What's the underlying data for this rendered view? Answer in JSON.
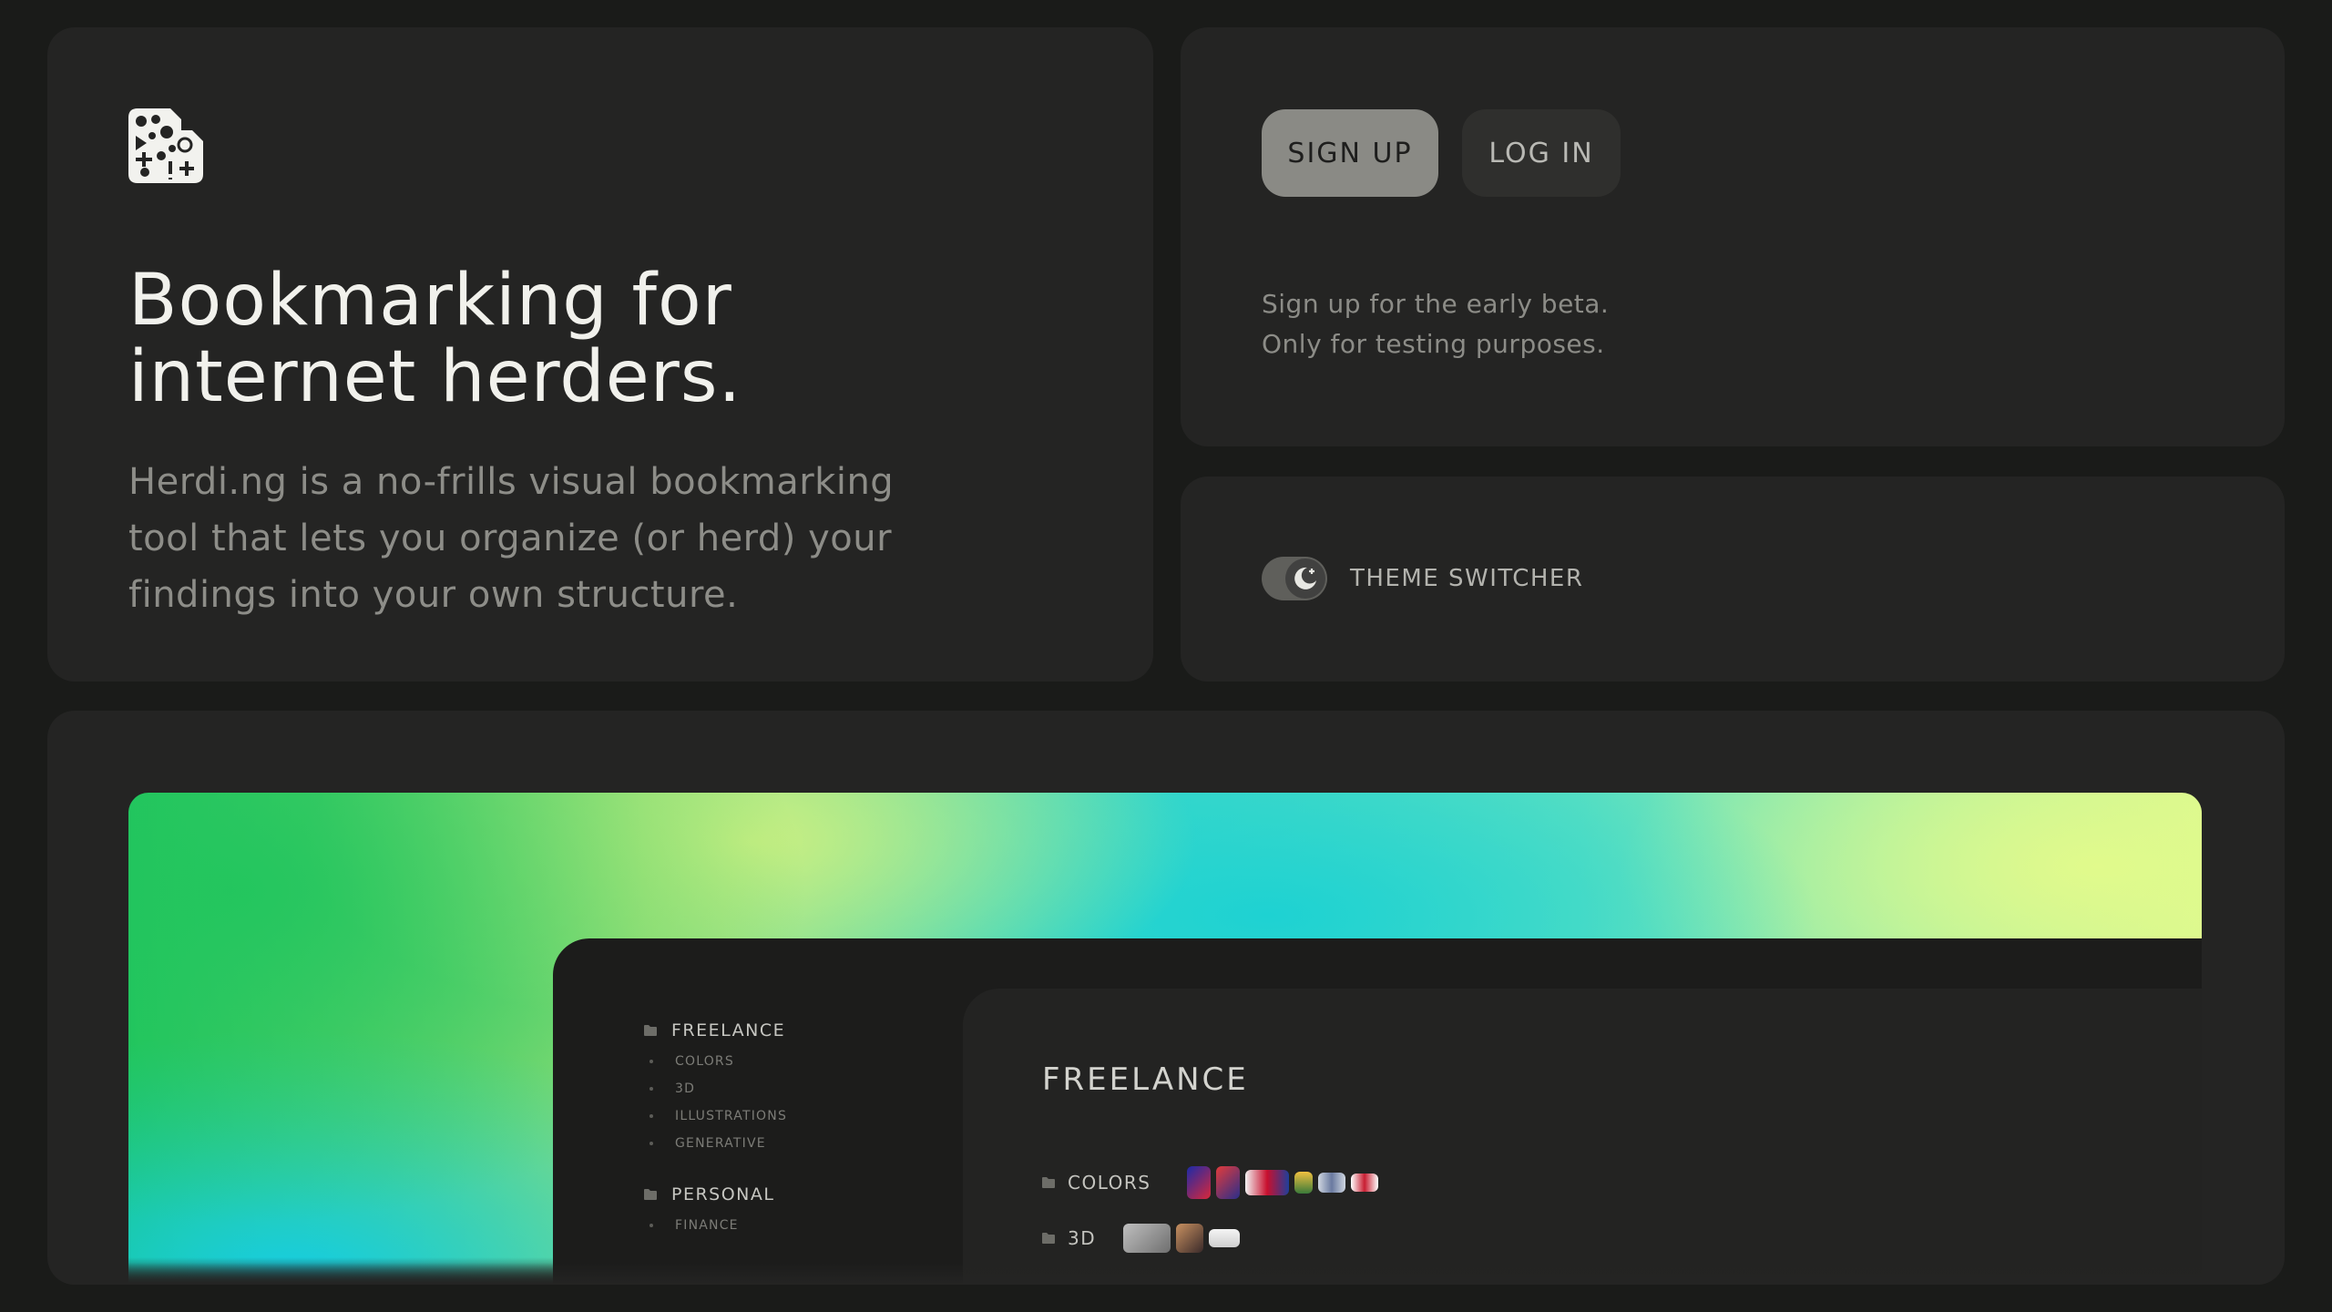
{
  "hero": {
    "title": "Bookmarking for\ninternet herders.",
    "description": "Herdi.ng is a no-frills visual bookmarking tool that lets you organize (or herd) your findings into your own structure."
  },
  "auth": {
    "signup_label": "SIGN UP",
    "login_label": "LOG IN",
    "beta_line1": "Sign up for the early beta.",
    "beta_line2": "Only for testing purposes."
  },
  "theme": {
    "label": "THEME SWITCHER",
    "mode_icon": "moon-icon"
  },
  "preview": {
    "sidebar": [
      {
        "label": "FREELANCE",
        "items": [
          "COLORS",
          "3D",
          "ILLUSTRATIONS",
          "GENERATIVE"
        ]
      },
      {
        "label": "PERSONAL",
        "items": [
          "FINANCE"
        ]
      }
    ],
    "content": {
      "title": "FREELANCE",
      "rows": [
        {
          "label": "COLORS"
        },
        {
          "label": "3D"
        }
      ]
    }
  },
  "colors": {
    "background": "#1a1b19",
    "card": "#242423",
    "signup_bg": "#8a8a85",
    "gradient_green": "#22c55e",
    "gradient_cyan": "#14cde6",
    "gradient_lime": "#d8f890"
  }
}
